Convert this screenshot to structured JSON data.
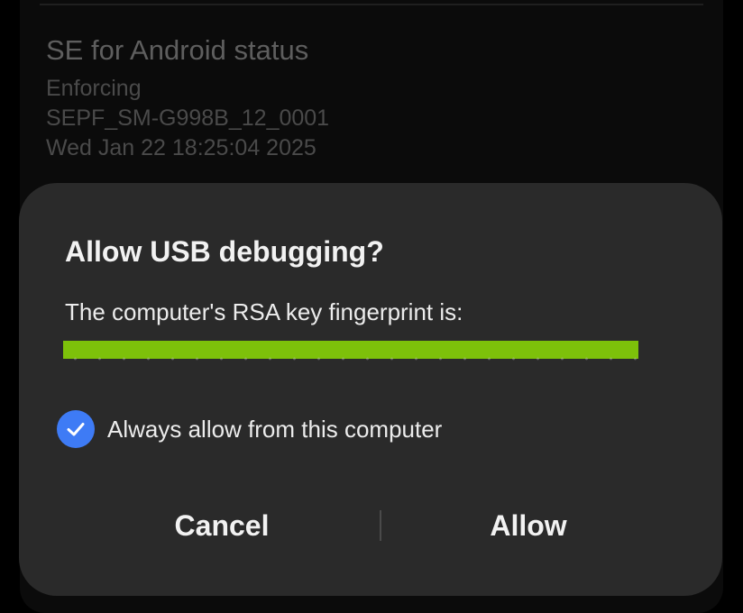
{
  "background": {
    "section_title": "SE for Android status",
    "lines": [
      "Enforcing",
      "SEPF_SM-G998B_12_0001",
      "Wed Jan 22 18:25:04 2025"
    ]
  },
  "dialog": {
    "title": "Allow USB debugging?",
    "message": "The computer's RSA key fingerprint is:",
    "fingerprint_redaction_color": "#7dc10a",
    "checkbox": {
      "label": "Always allow from this computer",
      "checked": true,
      "color": "#3e7bf5",
      "icon": "check-icon"
    },
    "buttons": {
      "cancel": "Cancel",
      "allow": "Allow"
    }
  }
}
